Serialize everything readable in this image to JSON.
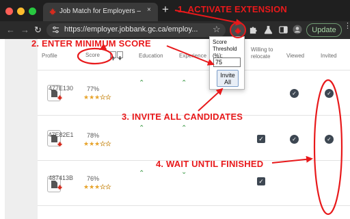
{
  "browser": {
    "tab_title": "Job Match for Employers – Emp",
    "tab_close": "×",
    "new_tab": "+",
    "back": "←",
    "forward": "→",
    "reload": "↻",
    "url": "https://employer.jobbank.gc.ca/employ...",
    "bookmark_icon": "☆",
    "update_label": "Update",
    "menu_icon": "⋮"
  },
  "table": {
    "headers": {
      "profile": "Profile",
      "score": "Score",
      "education": "Education",
      "experience": "Experience",
      "willing": "Willing to relocate",
      "viewed": "Viewed",
      "invited": "Invited"
    },
    "rows": [
      {
        "id": "477E130",
        "score": "77%",
        "stars_filled": 3,
        "stars_total": 5,
        "education": "up",
        "experience": "up",
        "willing": false,
        "viewed": true,
        "invited": true
      },
      {
        "id": "47E82E1",
        "score": "78%",
        "stars_filled": 3,
        "stars_total": 5,
        "education": "up",
        "experience": "up",
        "willing": true,
        "viewed": true,
        "invited": true
      },
      {
        "id": "487413B",
        "score": "76%",
        "stars_filled": 3,
        "stars_total": 5,
        "education": "up",
        "experience": "down",
        "willing": true,
        "viewed": false,
        "invited": false
      }
    ]
  },
  "popup": {
    "label": "Score Threshold (%):",
    "value": "75",
    "button": "Invite All"
  },
  "annotations": {
    "step1": "1. ACTIVATE EXTENSION",
    "step2": "2. ENTER MINIMUM SCORE",
    "step3": "3. INVITE ALL CANDIDATES",
    "step4": "4. WAIT UNTIL FINISHED",
    "color": "#e8191b"
  },
  "colors": {
    "accent_red": "#e8191b",
    "maple_red": "#d52b1e",
    "chevron_green": "#3c9a46",
    "check_dark": "#3d4752",
    "star_gold": "#e7a32a"
  }
}
